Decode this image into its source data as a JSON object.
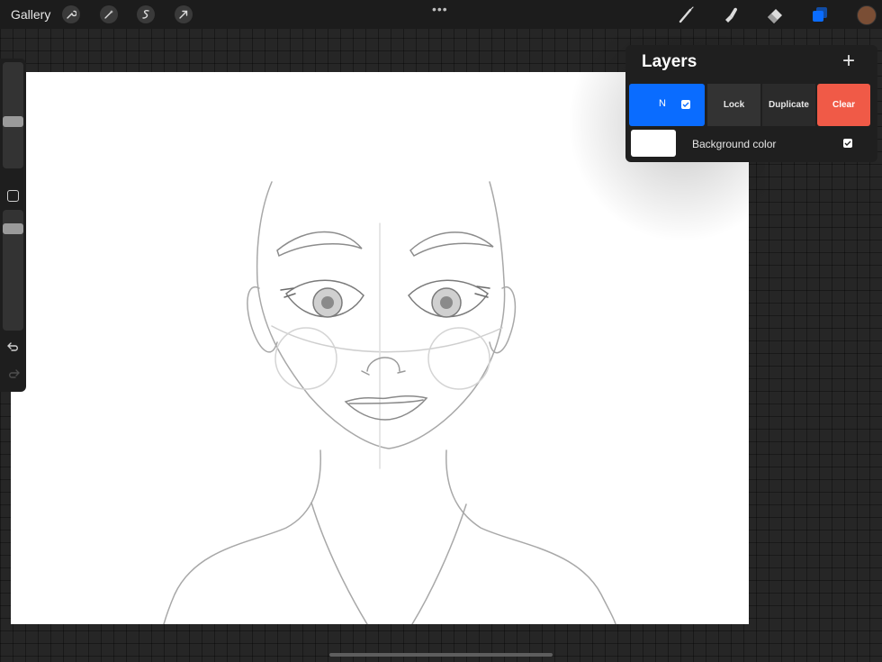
{
  "toolbar": {
    "gallery_label": "Gallery",
    "left_tools": [
      "wrench-icon",
      "magic-wand-icon",
      "selection-icon",
      "transform-arrow-icon"
    ],
    "more_label": "•••",
    "right_tools": [
      "brush-icon",
      "smudge-icon",
      "eraser-icon",
      "layers-icon"
    ],
    "current_color": "#7a4e35"
  },
  "layers_panel": {
    "title": "Layers",
    "add_label": "+",
    "active_layer": {
      "blend_mode": "N",
      "visible": true
    },
    "actions": {
      "lock_label": "Lock",
      "duplicate_label": "Duplicate",
      "clear_label": "Clear"
    },
    "background_layer": {
      "label": "Background color",
      "swatch_color": "#ffffff",
      "visible": true
    }
  },
  "colors": {
    "accent": "#0a6cff",
    "clear": "#f05a47",
    "panel": "#1f1f1f"
  }
}
